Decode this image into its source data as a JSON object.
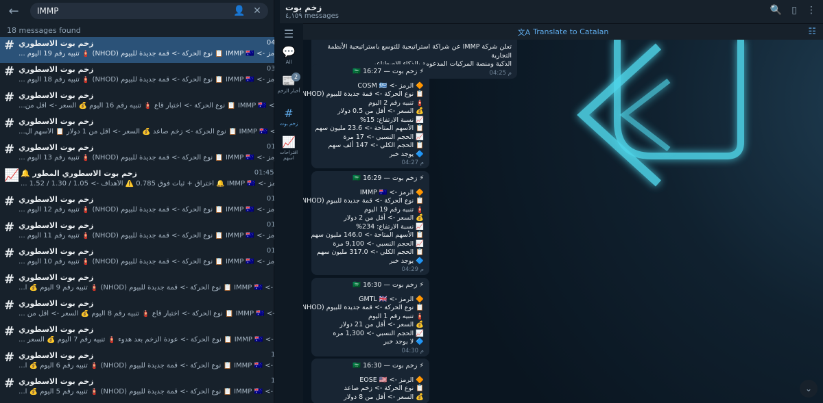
{
  "search": {
    "value": "IMMP",
    "found_text": "18 messages found"
  },
  "results": [
    {
      "title": "زخم بوت الاسطوري",
      "time": "م 04:29",
      "snippet": "🔶 الرمز -> IMMP 🇦🇺 📋 نوع الحركة -> قمة جديدة للبيوم (NHOD) 🧯 تنبيه رقم 19 اليوم ...",
      "active": true
    },
    {
      "title": "زخم بوت الاسطوري",
      "time": "م 03:37",
      "snippet": "🔶 الرمز -> IMMP 🇦🇺 📋 نوع الحركة -> قمة جديدة للبيوم (NHOD) 🧯 تنبيه رقم 18 اليوم ..."
    },
    {
      "title": "زخم بوت الاسطوري",
      "time": "م 03:33",
      "snippet": "🔶 الرمز -> IMMP 🇦🇺 📋 نوع الحركة -> اختبار قاع 🧯 تنبيه رقم 16 اليوم 💰 السعر -> أقل من..."
    },
    {
      "title": "زخم بوت الاسطوري",
      "time": "م 03:25",
      "snippet": "🔶 الرمز -> IMMP 🇦🇺 📋 نوع الحركة -> زخم صاعد 💰 السعر -> أقل من 1 دولار 📋 الأسهم ال..."
    },
    {
      "title": "زخم بوت الاسطوري",
      "time": "م 01:53",
      "snippet": "🔶 الرمز -> IMMP 🇦🇺 📋 نوع الحركة -> قمة جديدة للبيوم (NHOD) 🧯 تنبيه رقم 13 اليوم ..."
    },
    {
      "title": "زخم بوت الاسطوري المطور 🔔",
      "time": "م 01:45 ✓✓",
      "snippet": "⭐ الرمز -> IMMP 🇦🇺 🔔 اختراق + ثبات فوق 0.785 ⚠️ الأهداف -> 1.05 / 1.30 / 1.52 ...",
      "chart": true
    },
    {
      "title": "زخم بوت الاسطوري",
      "time": "م 01:40",
      "snippet": "🔶 الرمز -> IMMP 🇦🇺 📋 نوع الحركة -> قمة جديدة للبيوم (NHOD) 🧯 تنبيه رقم 12 اليوم ..."
    },
    {
      "title": "زخم بوت الاسطوري",
      "time": "م 01:25",
      "snippet": "🔶 الرمز -> IMMP 🇦🇺 📋 نوع الحركة -> قمة جديدة للبيوم (NHOD) 🧯 تنبيه رقم 11 اليوم ..."
    },
    {
      "title": "زخم بوت الاسطوري",
      "time": "م 01:17",
      "snippet": "🔶 الرمز -> IMMP 🇦🇺 📋 نوع الحركة -> قمة جديدة للبيوم (NHOD) 🧯 تنبيه رقم 10 اليوم ..."
    },
    {
      "title": "زخم بوت الاسطوري",
      "time": "م 01:11",
      "snippet": "🔶 الرمز -> IMMP 🇦🇺 📋 نوع الحركة -> قمة جديدة للبيوم (NHOD) 🧯 تنبيه رقم 9 اليوم 💰 ا..."
    },
    {
      "title": "زخم بوت الاسطوري",
      "time": "م 01:06",
      "snippet": "🔶 الرمز -> IMMP 🇦🇺 📋 نوع الحركة -> اختبار قاع 🧯 تنبيه رقم 8 اليوم 💰 السعر -> أقل من ..."
    },
    {
      "title": "زخم بوت الاسطوري",
      "time": "م 12:40",
      "snippet": "🔶 الرمز -> IMMP 🇦🇺 📋 نوع الحركة -> عودة الزخم بعد هدوء 🧯 تنبيه رقم 7 اليوم 💰 السعر ..."
    },
    {
      "title": "زخم بوت الاسطوري",
      "time": "ص 11:31",
      "snippet": "🔶 الرمز -> IMMP 🇦🇺 📋 نوع الحركة -> قمة جديدة للبيوم (NHOD) 🧯 تنبيه رقم 6 اليوم 💰 ا..."
    },
    {
      "title": "زخم بوت الاسطوري",
      "time": "ص 11:25",
      "snippet": "🔶 الرمز -> IMMP 🇦🇺 📋 نوع الحركة -> قمة جديدة للبيوم (NHOD) 🧯 تنبيه رقم 5 اليوم 💰 ا..."
    }
  ],
  "rail": [
    {
      "icon": "menu-icon",
      "glyph": "☰",
      "label": ""
    },
    {
      "icon": "chat-bubbles-icon",
      "glyph": "💬",
      "label": "All"
    },
    {
      "icon": "news-icon",
      "glyph": "📰",
      "label": "أخبار الزخم",
      "badge": "2"
    },
    {
      "icon": "hashtag-icon",
      "glyph": "#",
      "label": "زخم بوت",
      "active": true
    },
    {
      "icon": "chart-icon",
      "glyph": "📈",
      "label": "اقتراحات اسهم"
    }
  ],
  "chat": {
    "title": "زخم بوت",
    "subtitle": "٤,١٥٩ messages",
    "translate": "Translate to Catalan"
  },
  "messages": [
    {
      "lines": [
        "تعلن شركة IMMP عن شراكة استراتيجية للتوسع باستراتيجية الأنظمة التجارية",
        "الذكية ومنصة المركبات المدعومة بالذكاء الاصطناعي."
      ],
      "time": "04:25 م"
    },
    {
      "head": "⚡ زخم بوت — 16:27 🇸🇦",
      "lines": [
        "🔶 الرمز -> COSM 🇬🇷",
        "📋 نوع الحركة -> قمة جديدة للبيوم (NHOD)",
        "🧯 تنبيه رقم 2 اليوم",
        "💰 السعر -> أقل من 0.5 دولار",
        "📈 نسبة الارتفاع: 15%",
        "📋 الأسهم المتاحة -> 23.6 مليون سهم",
        "📈 الحجم النسبي -> 17 مرة",
        "📋 الحجم الكلي -> 147 ألف سهم",
        "🔷 يوجد خبر"
      ],
      "time": "04:27 م"
    },
    {
      "head": "⚡ زخم بوت — 16:29 🇸🇦",
      "lines": [
        "🔶 الرمز -> IMMP 🇦🇺",
        "📋 نوع الحركة -> قمة جديدة للبيوم (NHOD)",
        "🧯 تنبيه رقم 19 اليوم",
        "💰 السعر -> أقل من 2 دولار",
        "📈 نسبة الارتفاع: 234%",
        "📋 الأسهم المتاحة -> 146.0 مليون سهم",
        "📈 الحجم النسبي -> 9,100 مرة",
        "📋 الحجم الكلي -> 317.0 مليون سهم",
        "🔷 يوجد خبر"
      ],
      "time": "04:29 م"
    },
    {
      "head": "⚡ زخم بوت — 16:30 🇸🇦",
      "lines": [
        "🔶 الرمز -> GMTL 🇬🇧",
        "📋 نوع الحركة -> قمة جديدة للبيوم (NHOD)",
        "🧯 تنبيه رقم 1 اليوم",
        "💰 السعر -> أقل من 21 دولار",
        "📈 الحجم النسبي -> 1,300 مرة",
        "🔷 لا يوجد خبر"
      ],
      "time": "04:30 م"
    },
    {
      "head": "⚡ زخم بوت — 16:30 🇸🇦",
      "lines": [
        "🔶 الرمز -> EOSE 🇺🇸",
        "📋 نوع الحركة -> زخم صاعد",
        "💰 السعر -> أقل من 8 دولار"
      ],
      "time": ""
    }
  ],
  "colors": {
    "accent": "#5ea9e8",
    "active_row": "#2b5278",
    "panel": "#17212b",
    "bubble": "#182533"
  }
}
